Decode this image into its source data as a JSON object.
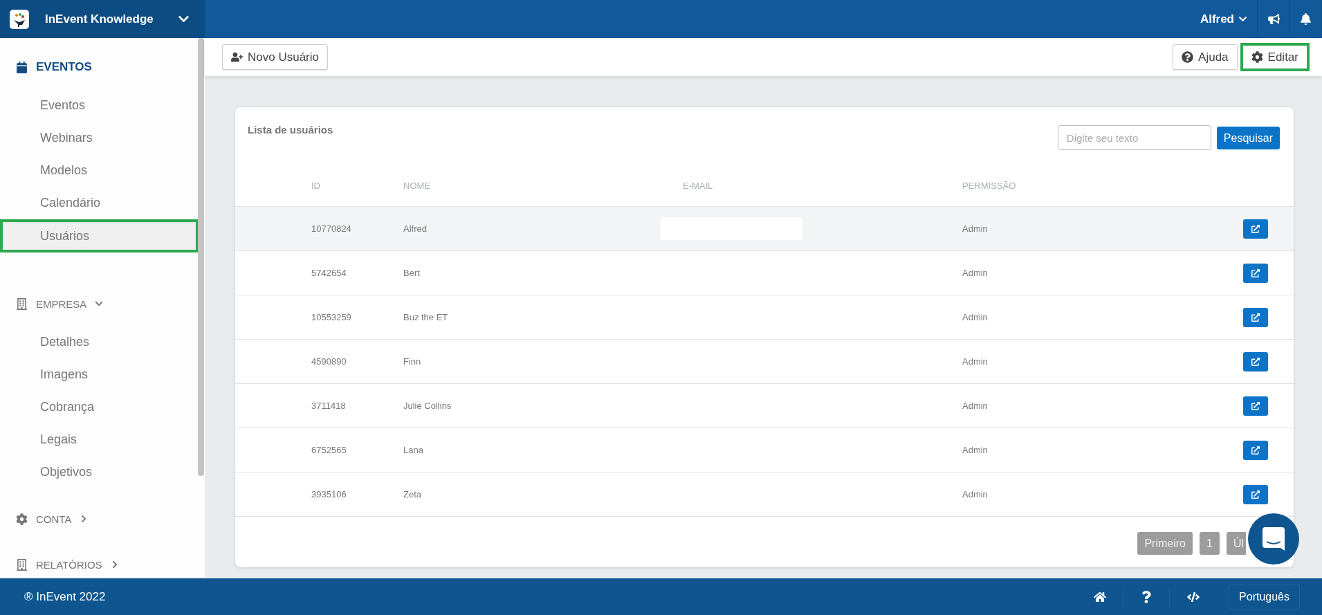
{
  "header": {
    "org": "InEvent Knowledge",
    "user": "Alfred"
  },
  "sidebar": {
    "sections": [
      {
        "kind": "main",
        "label": "EVENTOS",
        "items": [
          {
            "label": "Eventos",
            "selected": false
          },
          {
            "label": "Webinars",
            "selected": false
          },
          {
            "label": "Modelos",
            "selected": false
          },
          {
            "label": "Calendário",
            "selected": false
          },
          {
            "label": "Usuários",
            "selected": true
          }
        ]
      },
      {
        "kind": "group",
        "label": "EMPRESA",
        "expanded": true,
        "items": [
          {
            "label": "Detalhes",
            "selected": false
          },
          {
            "label": "Imagens",
            "selected": false
          },
          {
            "label": "Cobrança",
            "selected": false
          },
          {
            "label": "Legais",
            "selected": false
          },
          {
            "label": "Objetivos",
            "selected": false
          }
        ]
      },
      {
        "kind": "group",
        "label": "CONTA",
        "expanded": false
      },
      {
        "kind": "group",
        "label": "RELATÓRIOS",
        "expanded": false
      }
    ]
  },
  "toolbar": {
    "new_user": "Novo Usuário",
    "help": "Ajuda",
    "edit": {
      "label": "Editar",
      "highlighted": true
    }
  },
  "card": {
    "title": "Lista de usuários",
    "search": {
      "placeholder": "Digite seu texto",
      "button": "Pesquisar"
    },
    "columns": [
      "ID",
      "NOME",
      "E-MAIL",
      "PERMISSÃO"
    ],
    "rows": [
      {
        "id": "10770824",
        "name": "Alfred",
        "permission": "Admin",
        "hovered": true
      },
      {
        "id": "5742654",
        "name": "Bert",
        "permission": "Admin",
        "hovered": false
      },
      {
        "id": "10553259",
        "name": "Buz the ET",
        "permission": "Admin",
        "hovered": false
      },
      {
        "id": "4590890",
        "name": "Finn",
        "permission": "Admin",
        "hovered": false
      },
      {
        "id": "3711418",
        "name": "Julie Collins",
        "permission": "Admin",
        "hovered": false
      },
      {
        "id": "6752565",
        "name": "Lana",
        "permission": "Admin",
        "hovered": false
      },
      {
        "id": "3935106",
        "name": "Zeta",
        "permission": "Admin",
        "hovered": false
      }
    ],
    "pagination": [
      {
        "label": "Primeiro"
      },
      {
        "label": "1"
      },
      {
        "label": "Úl"
      }
    ]
  },
  "footer": {
    "copyright": "® InEvent 2022",
    "language": "Português"
  }
}
